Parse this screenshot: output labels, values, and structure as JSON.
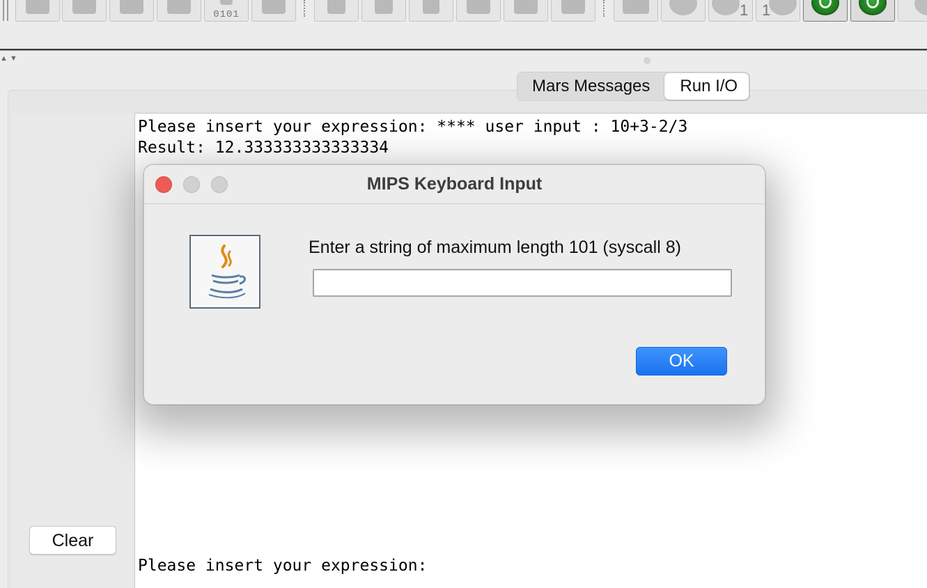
{
  "toolbar": {
    "buttons": [
      {
        "icon": "new-file-icon"
      },
      {
        "icon": "open-file-icon"
      },
      {
        "icon": "save-icon"
      },
      {
        "icon": "save-as-icon"
      },
      {
        "icon": "dump-memory-icon",
        "label": "0101"
      },
      {
        "icon": "print-icon"
      },
      {
        "icon": "undo-icon"
      },
      {
        "icon": "redo-icon"
      },
      {
        "icon": "cut-icon"
      },
      {
        "icon": "copy-icon"
      },
      {
        "icon": "paste-icon"
      },
      {
        "icon": "find-replace-icon"
      },
      {
        "icon": "assemble-icon"
      },
      {
        "icon": "run-icon"
      },
      {
        "icon": "step-icon",
        "label": "1"
      },
      {
        "icon": "backstep-icon",
        "label": "1"
      },
      {
        "icon": "pause-icon"
      },
      {
        "icon": "stop-icon"
      },
      {
        "icon": "reset-icon"
      }
    ]
  },
  "tabs": {
    "mars_messages": "Mars Messages",
    "run_io": "Run I/O",
    "selected": "run_io"
  },
  "console": {
    "line1": "Please insert your expression: **** user input : 10+3-2/3",
    "line2": "Result: 12.333333333333334",
    "line3": "Please insert your expression:"
  },
  "clear_button": "Clear",
  "dialog": {
    "title": "MIPS Keyboard Input",
    "prompt": "Enter a string of maximum length 101 (syscall 8)",
    "input_value": "",
    "ok_label": "OK",
    "icon": "java-logo-icon"
  },
  "colors": {
    "ok_button": "#1a73f0",
    "close_traffic_light": "#ee5b55",
    "run_green": "#2a8f2a"
  }
}
